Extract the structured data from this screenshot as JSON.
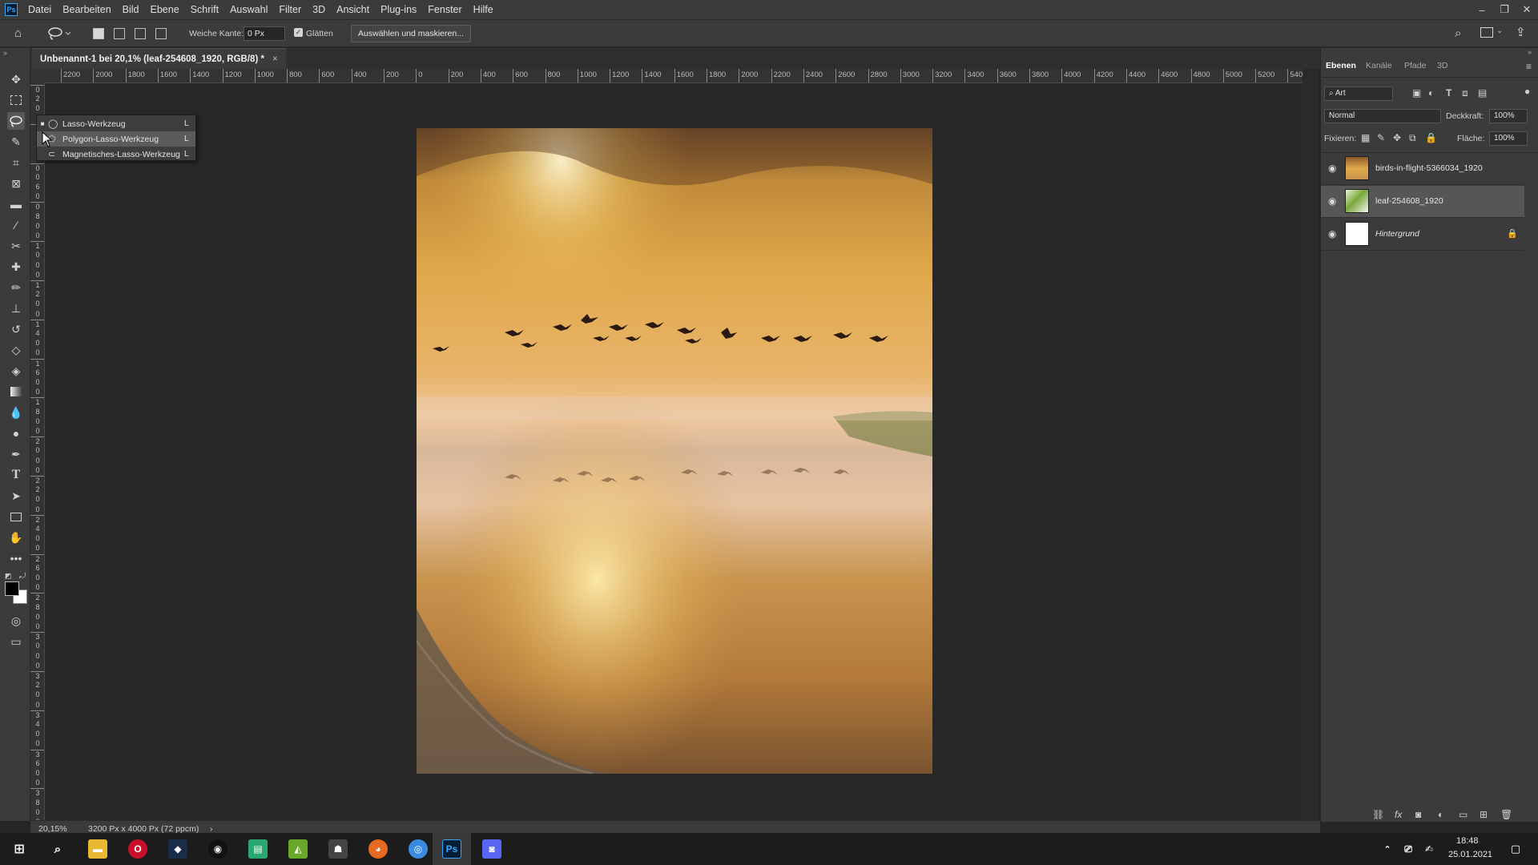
{
  "app": {
    "logo": "Ps",
    "menu": [
      "Datei",
      "Bearbeiten",
      "Bild",
      "Ebene",
      "Schrift",
      "Auswahl",
      "Filter",
      "3D",
      "Ansicht",
      "Plug-ins",
      "Fenster",
      "Hilfe"
    ]
  },
  "options": {
    "feather_label": "Weiche Kante:",
    "feather_value": "0 Px",
    "antialias_label": "Glätten",
    "select_mask_label": "Auswählen und maskieren..."
  },
  "document": {
    "tab_title": "Unbenannt-1 bei 20,1% (leaf-254608_1920, RGB/8) *",
    "tab_close": "×"
  },
  "ruler_top": [
    "2200",
    "2000",
    "1800",
    "1600",
    "1400",
    "1200",
    "1000",
    "800",
    "600",
    "400",
    "200",
    "0",
    "200",
    "400",
    "600",
    "800",
    "1000",
    "1200",
    "1400",
    "1600",
    "1800",
    "2000",
    "2200",
    "2400",
    "2600",
    "2800",
    "3000",
    "3200",
    "3400",
    "3600",
    "3800",
    "4000",
    "4200",
    "4400",
    "4600",
    "4800",
    "5000",
    "5200",
    "540"
  ],
  "ruler_left": [
    "0",
    "2",
    "0",
    "0",
    "2",
    "0",
    "0",
    "4",
    "0",
    "0",
    "6",
    "0",
    "0",
    "8",
    "0",
    "0",
    "1",
    "0",
    "0",
    "0",
    "1",
    "2",
    "0",
    "0",
    "1",
    "4",
    "0",
    "0",
    "1",
    "6",
    "0",
    "0",
    "1",
    "8",
    "0",
    "0",
    "2",
    "0",
    "0",
    "0",
    "2",
    "2",
    "0",
    "0",
    "2",
    "4",
    "0",
    "0",
    "2",
    "6",
    "0",
    "0",
    "2",
    "8",
    "0",
    "0",
    "3",
    "0",
    "0",
    "0",
    "3",
    "2",
    "0",
    "0",
    "3",
    "4",
    "0",
    "0",
    "3",
    "6",
    "0",
    "0",
    "3",
    "8",
    "0",
    "0",
    "4",
    "0"
  ],
  "flyout": {
    "items": [
      {
        "label": "Lasso-Werkzeug",
        "shortcut": "L",
        "marker": "■"
      },
      {
        "label": "Polygon-Lasso-Werkzeug",
        "shortcut": "L",
        "marker": ""
      },
      {
        "label": "Magnetisches-Lasso-Werkzeug",
        "shortcut": "L",
        "marker": ""
      }
    ]
  },
  "status": {
    "zoom": "20,15%",
    "doc_size": "3200 Px x 4000 Px (72 ppcm)",
    "arrow": "›"
  },
  "panel": {
    "tabs": [
      "Ebenen",
      "Kanäle",
      "Pfade",
      "3D"
    ],
    "filter_kind": "Art",
    "blend_mode": "Normal",
    "opacity_label": "Deckkraft:",
    "opacity_value": "100%",
    "lock_label": "Fixieren:",
    "fill_label": "Fläche:",
    "fill_value": "100%",
    "layers": [
      {
        "name": "birds-in-flight-5366034_1920",
        "selected": false
      },
      {
        "name": "leaf-254608_1920",
        "selected": true
      },
      {
        "name": "Hintergrund",
        "selected": false
      }
    ]
  },
  "taskbar": {
    "time": "18:48",
    "date": "25.01.2021"
  },
  "colors": {
    "accent": "#31a8ff",
    "panel_bg": "#3b3b3b",
    "canvas_bg": "#282828"
  }
}
